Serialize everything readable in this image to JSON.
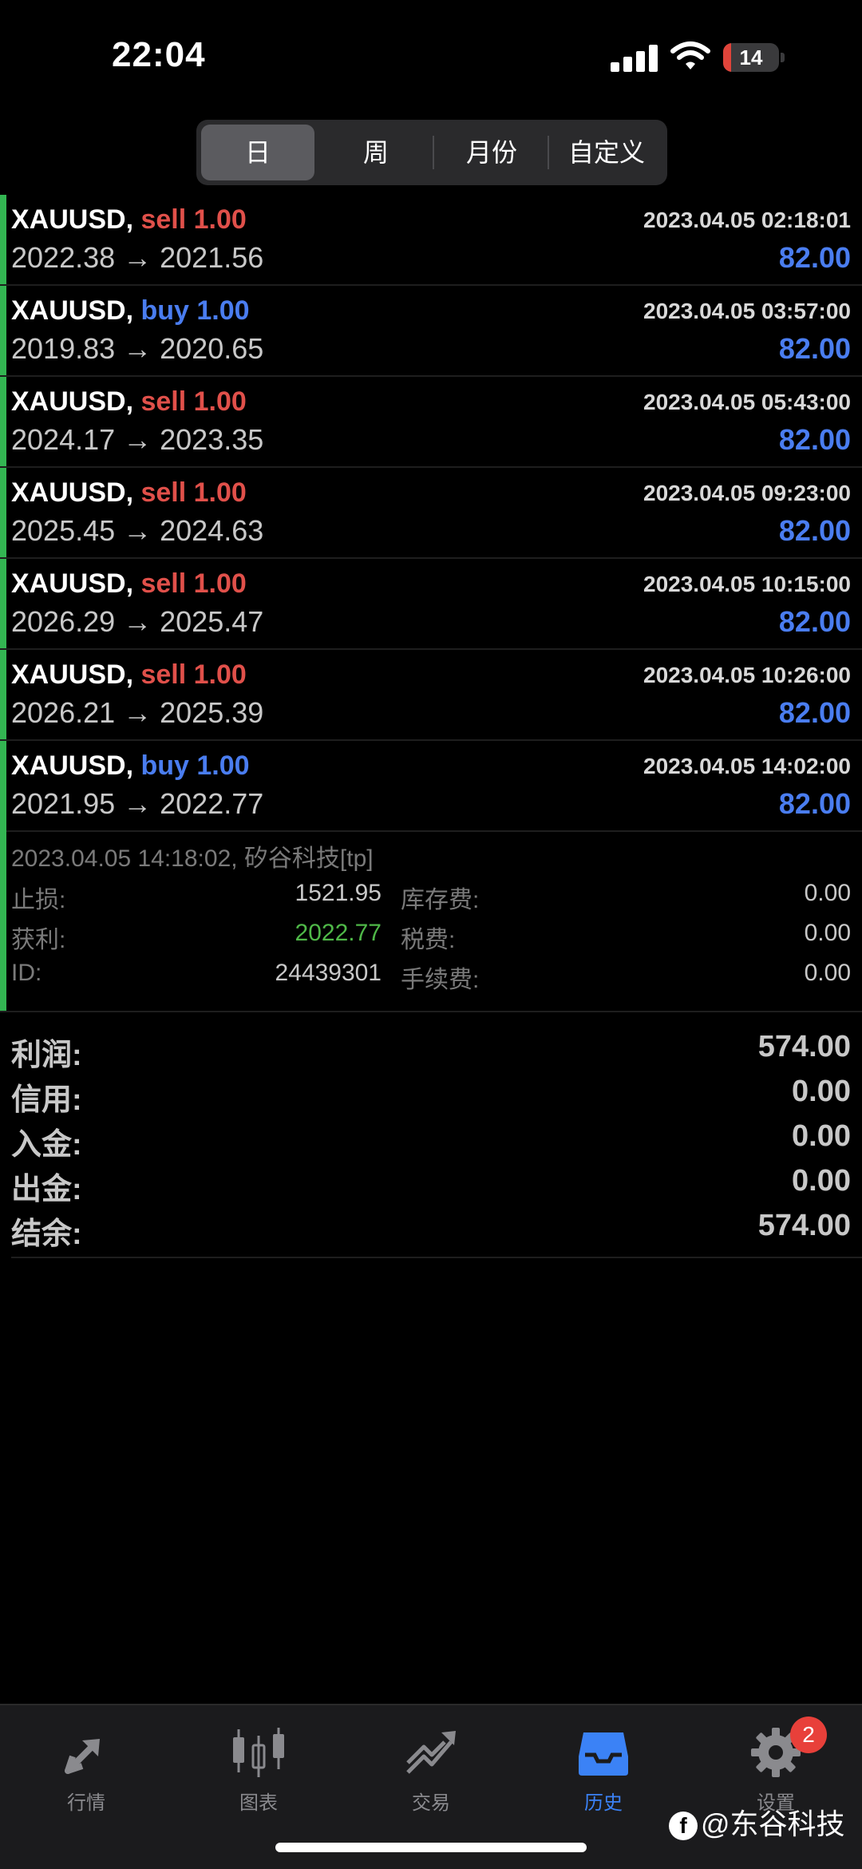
{
  "status_bar": {
    "time": "22:04",
    "battery": "14",
    "battery_level": 0.14
  },
  "tabs": [
    {
      "label": "日",
      "active": true
    },
    {
      "label": "周",
      "active": false
    },
    {
      "label": "月份",
      "active": false
    },
    {
      "label": "自定义",
      "active": false
    }
  ],
  "trades": [
    {
      "symbol": "XAUUSD,",
      "side": "sell 1.00",
      "type": "sell",
      "time": "2023.04.05 02:18:01",
      "prices": "2022.38 → 2021.56",
      "profit": "82.00"
    },
    {
      "symbol": "XAUUSD,",
      "side": "buy 1.00",
      "type": "buy",
      "time": "2023.04.05 03:57:00",
      "prices": "2019.83 → 2020.65",
      "profit": "82.00"
    },
    {
      "symbol": "XAUUSD,",
      "side": "sell 1.00",
      "type": "sell",
      "time": "2023.04.05 05:43:00",
      "prices": "2024.17 → 2023.35",
      "profit": "82.00"
    },
    {
      "symbol": "XAUUSD,",
      "side": "sell 1.00",
      "type": "sell",
      "time": "2023.04.05 09:23:00",
      "prices": "2025.45 → 2024.63",
      "profit": "82.00"
    },
    {
      "symbol": "XAUUSD,",
      "side": "sell 1.00",
      "type": "sell",
      "time": "2023.04.05 10:15:00",
      "prices": "2026.29 → 2025.47",
      "profit": "82.00"
    },
    {
      "symbol": "XAUUSD,",
      "side": "sell 1.00",
      "type": "sell",
      "time": "2023.04.05 10:26:00",
      "prices": "2026.21 → 2025.39",
      "profit": "82.00"
    },
    {
      "symbol": "XAUUSD,",
      "side": "buy 1.00",
      "type": "buy",
      "time": "2023.04.05 14:02:00",
      "prices": "2021.95 → 2022.77",
      "profit": "82.00"
    }
  ],
  "detail": {
    "close_info": "2023.04.05 14:18:02, 矽谷科技[tp]",
    "sl_label": "止损:",
    "sl_value": "1521.95",
    "tp_label": "获利:",
    "tp_value": "2022.77",
    "id_label": "ID:",
    "id_value": "24439301",
    "swap_label": "库存费:",
    "swap_value": "0.00",
    "tax_label": "税费:",
    "tax_value": "0.00",
    "fee_label": "手续费:",
    "fee_value": "0.00"
  },
  "summary": [
    {
      "label": "利润:",
      "value": "574.00"
    },
    {
      "label": "信用:",
      "value": "0.00"
    },
    {
      "label": "入金:",
      "value": "0.00"
    },
    {
      "label": "出金:",
      "value": "0.00"
    },
    {
      "label": "结余:",
      "value": "574.00"
    }
  ],
  "nav": [
    {
      "label": "行情",
      "icon": "quotes-icon",
      "active": false
    },
    {
      "label": "图表",
      "icon": "chart-icon",
      "active": false
    },
    {
      "label": "交易",
      "icon": "trade-icon",
      "active": false
    },
    {
      "label": "历史",
      "icon": "history-icon",
      "active": true
    },
    {
      "label": "设置",
      "icon": "settings-icon",
      "active": false
    }
  ],
  "settings_badge": "2",
  "watermark": "@东谷科技",
  "colors": {
    "sell": "#e0504a",
    "buy": "#4a7df0",
    "accent_green": "#33b552",
    "active_blue": "#3b82f6"
  }
}
